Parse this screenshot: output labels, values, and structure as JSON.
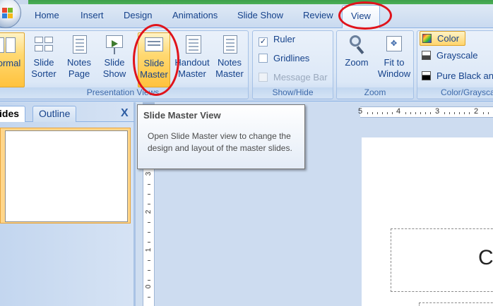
{
  "tabs": {
    "home": "Home",
    "insert": "Insert",
    "design": "Design",
    "animations": "Animations",
    "slide_show": "Slide Show",
    "review": "Review",
    "view": "View"
  },
  "ribbon": {
    "presentation_views": {
      "label": "Presentation Views",
      "buttons": {
        "normal": [
          "ormal",
          ""
        ],
        "slide_sorter": [
          "Slide",
          "Sorter"
        ],
        "notes_page": [
          "Notes",
          "Page"
        ],
        "slide_show": [
          "Slide",
          "Show"
        ],
        "slide_master": [
          "Slide",
          "Master"
        ],
        "handout_master": [
          "Handout",
          "Master"
        ],
        "notes_master": [
          "Notes",
          "Master"
        ]
      }
    },
    "show_hide": {
      "label": "Show/Hide",
      "ruler": {
        "label": "Ruler",
        "checked": true
      },
      "gridlines": {
        "label": "Gridlines",
        "checked": false
      },
      "message_bar": {
        "label": "Message Bar",
        "checked": false,
        "disabled": true
      }
    },
    "zoom": {
      "label": "Zoom",
      "zoom_btn": "Zoom",
      "fit_to_window": [
        "Fit to",
        "Window"
      ]
    },
    "color_grayscale": {
      "label": "Color/Graysca",
      "color": "Color",
      "grayscale": "Grayscale",
      "pure_black": "Pure Black and"
    }
  },
  "left_pane": {
    "tab_slides": "ides",
    "tab_outline": "Outline",
    "close": "X"
  },
  "tooltip": {
    "title": "Slide Master View",
    "body": "Open Slide Master view to change the design and layout of the master slides."
  },
  "rulers": {
    "h_numbers": [
      "5",
      "4",
      "3",
      "2"
    ],
    "v_numbers": [
      "3",
      "2",
      "1",
      "0"
    ]
  },
  "slide": {
    "title_partial": "C"
  },
  "colors": {
    "highlight": "#ffd46b",
    "annotation_red": "#e0131b",
    "ribbon_text": "#15428b"
  }
}
